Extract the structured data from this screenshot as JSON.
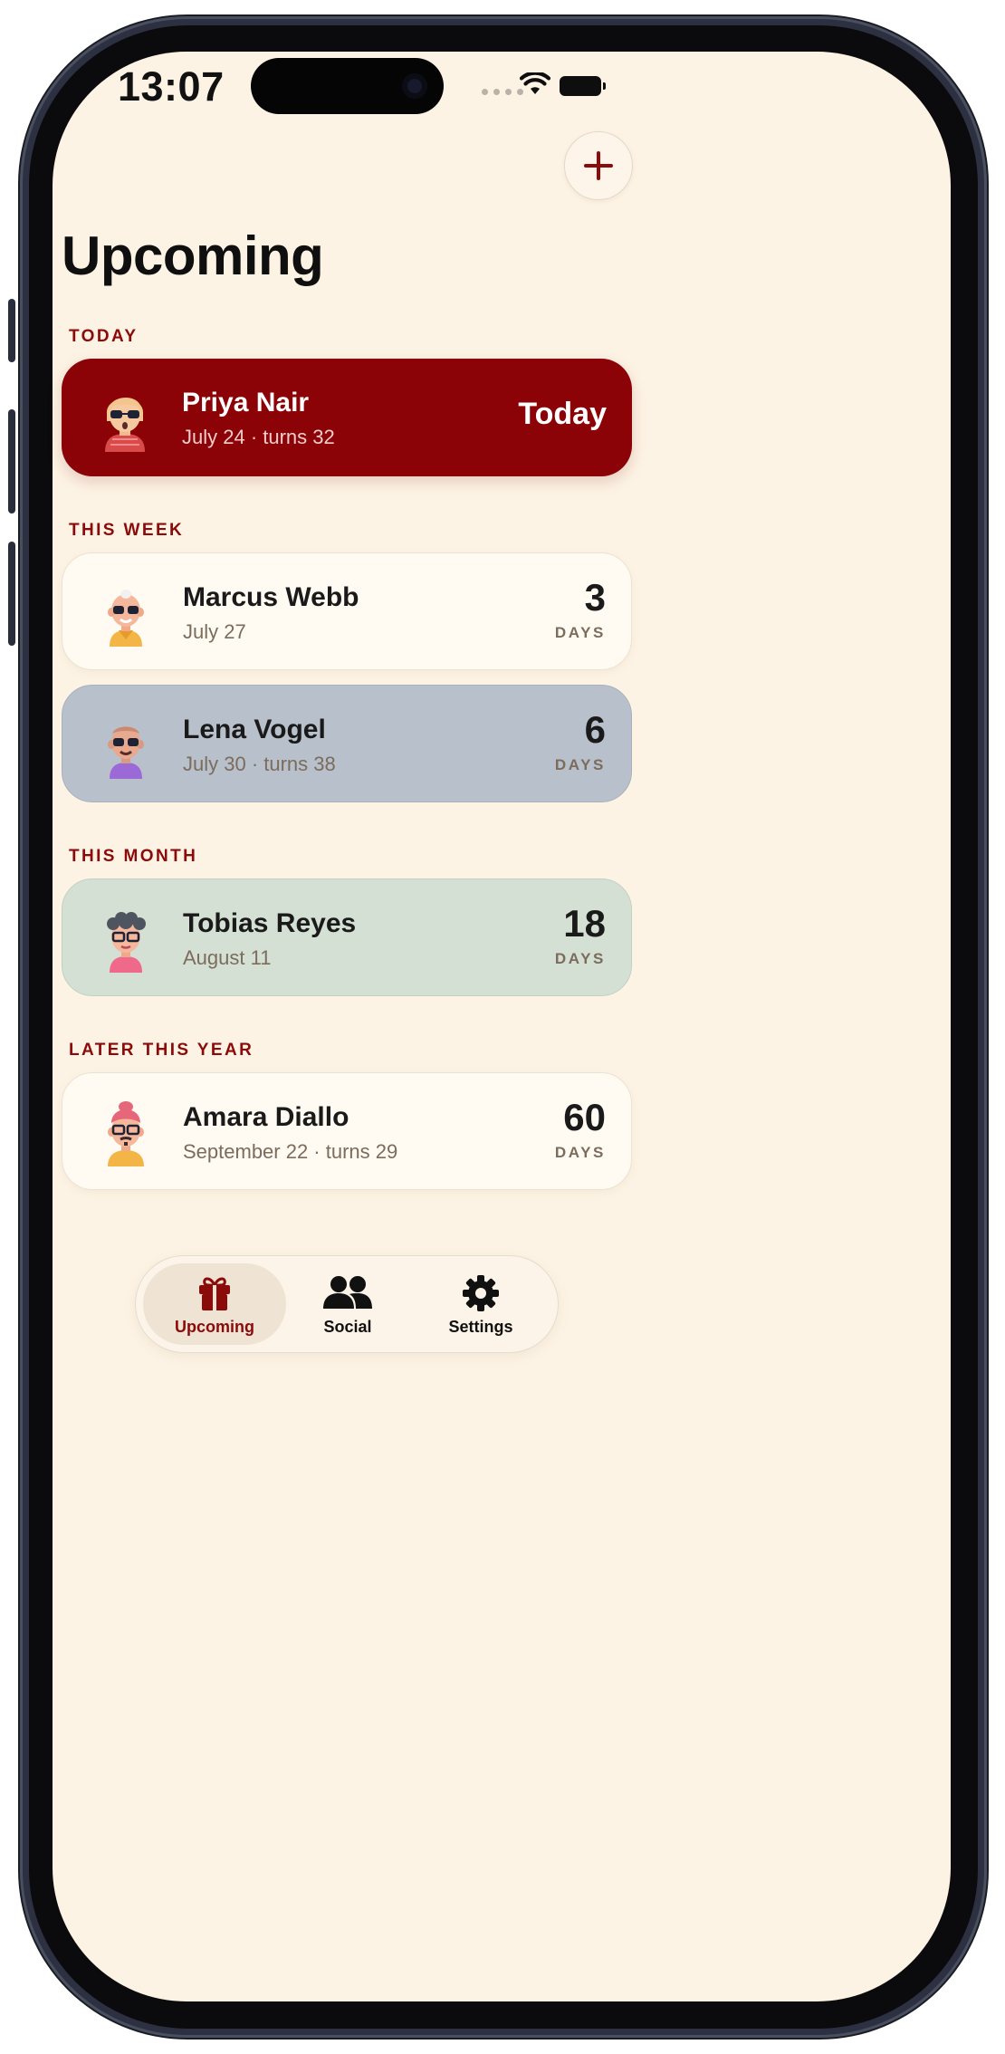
{
  "status": {
    "time": "13:07"
  },
  "header": {
    "title": "Upcoming",
    "add_icon": "plus-icon"
  },
  "sections": [
    {
      "label": "TODAY"
    },
    {
      "label": "THIS WEEK"
    },
    {
      "label": "THIS MONTH"
    },
    {
      "label": "LATER THIS YEAR"
    }
  ],
  "entries": [
    {
      "name": "Priya Nair",
      "detail": "July 24 · turns 32",
      "badge": "Today",
      "count": "",
      "unit": ""
    },
    {
      "name": "Marcus Webb",
      "detail": "July 27",
      "badge": "",
      "count": "3",
      "unit": "DAYS"
    },
    {
      "name": "Lena Vogel",
      "detail": "July 30 · turns 38",
      "badge": "",
      "count": "6",
      "unit": "DAYS"
    },
    {
      "name": "Tobias Reyes",
      "detail": "August 11",
      "badge": "",
      "count": "18",
      "unit": "DAYS"
    },
    {
      "name": "Amara Diallo",
      "detail": "September 22 · turns 29",
      "badge": "",
      "count": "60",
      "unit": "DAYS"
    }
  ],
  "tabs": [
    {
      "label": "Upcoming",
      "icon": "gift-icon",
      "active": true
    },
    {
      "label": "Social",
      "icon": "people-icon",
      "active": false
    },
    {
      "label": "Settings",
      "icon": "gear-icon",
      "active": false
    }
  ],
  "colors": {
    "accent": "#8b0a0a",
    "today_card": "#8b0306",
    "background": "#fdf3e4",
    "grey_card": "#b8c0cb",
    "green_card": "#d3e0d3"
  }
}
